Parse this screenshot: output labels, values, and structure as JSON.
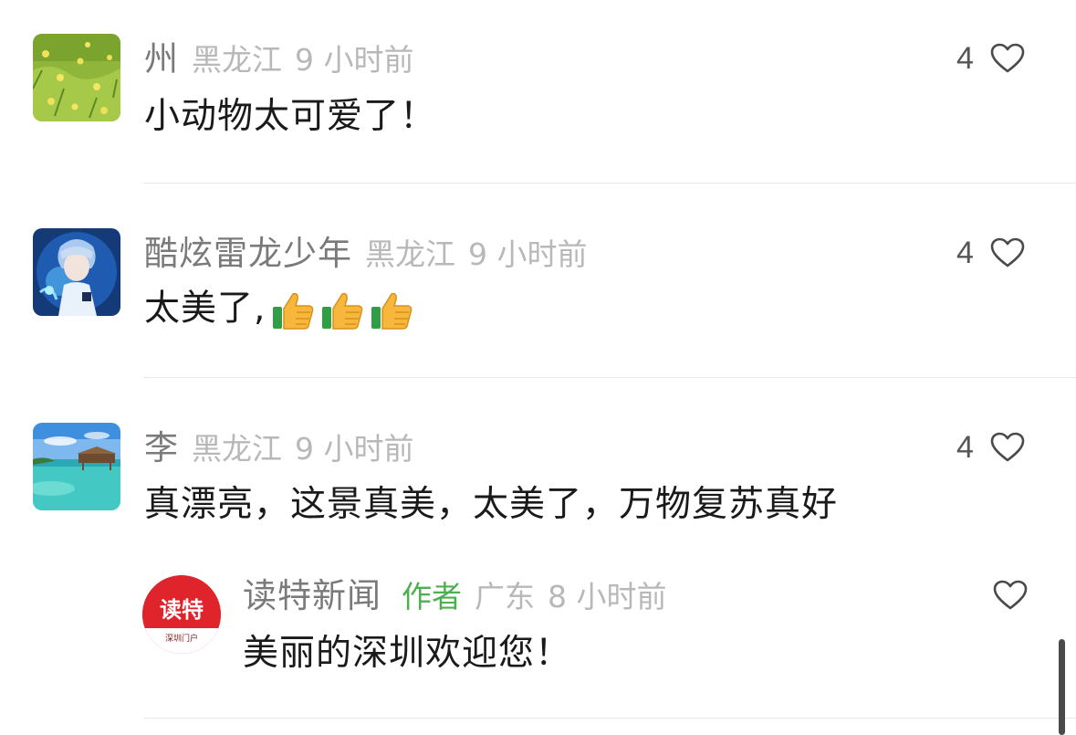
{
  "comments": [
    {
      "name": "州",
      "region": "黑龙江",
      "time": "9 小时前",
      "content": "小动物太可爱了！",
      "like_count": "4",
      "avatar_icon": "grass-flowers-avatar"
    },
    {
      "name": "酷炫雷龙少年",
      "region": "黑龙江",
      "time": "9 小时前",
      "content": "太美了,",
      "emoji": [
        "thumbs-up",
        "thumbs-up",
        "thumbs-up"
      ],
      "like_count": "4",
      "avatar_icon": "anime-boy-avatar"
    },
    {
      "name": "李",
      "region": "黑龙江",
      "time": "9 小时前",
      "content": "真漂亮，这景真美，太美了，万物复苏真好",
      "like_count": "4",
      "avatar_icon": "beach-avatar"
    }
  ],
  "reply": {
    "name": "读特新闻",
    "author_tag": "作者",
    "region": "广东",
    "time": "8 小时前",
    "content": "美丽的深圳欢迎您！",
    "avatar_text": "读特",
    "avatar_subtext": "深圳门户",
    "like_icon": "heart-outline-icon"
  },
  "colors": {
    "author_tag": "#4caf50",
    "avatar_red": "#e0242b",
    "meta_gray": "#b8b8b8"
  }
}
